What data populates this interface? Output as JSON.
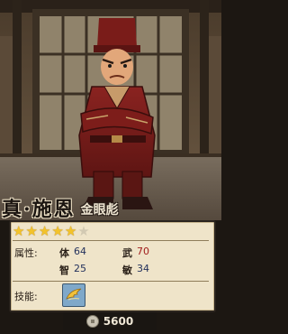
{
  "character": {
    "name": "真·施恩",
    "nickname": "金眼彪",
    "rating_stars": 5,
    "rating_max": 6
  },
  "stats": {
    "label": "属性:",
    "items": [
      {
        "name": "体",
        "value": "64"
      },
      {
        "name": "武",
        "value": "70"
      },
      {
        "name": "智",
        "value": "25"
      },
      {
        "name": "敏",
        "value": "34"
      }
    ]
  },
  "skills": {
    "label": "技能:",
    "icon": "golden-wing-icon"
  },
  "cost": {
    "icon": "coin-icon",
    "value": "5600"
  }
}
